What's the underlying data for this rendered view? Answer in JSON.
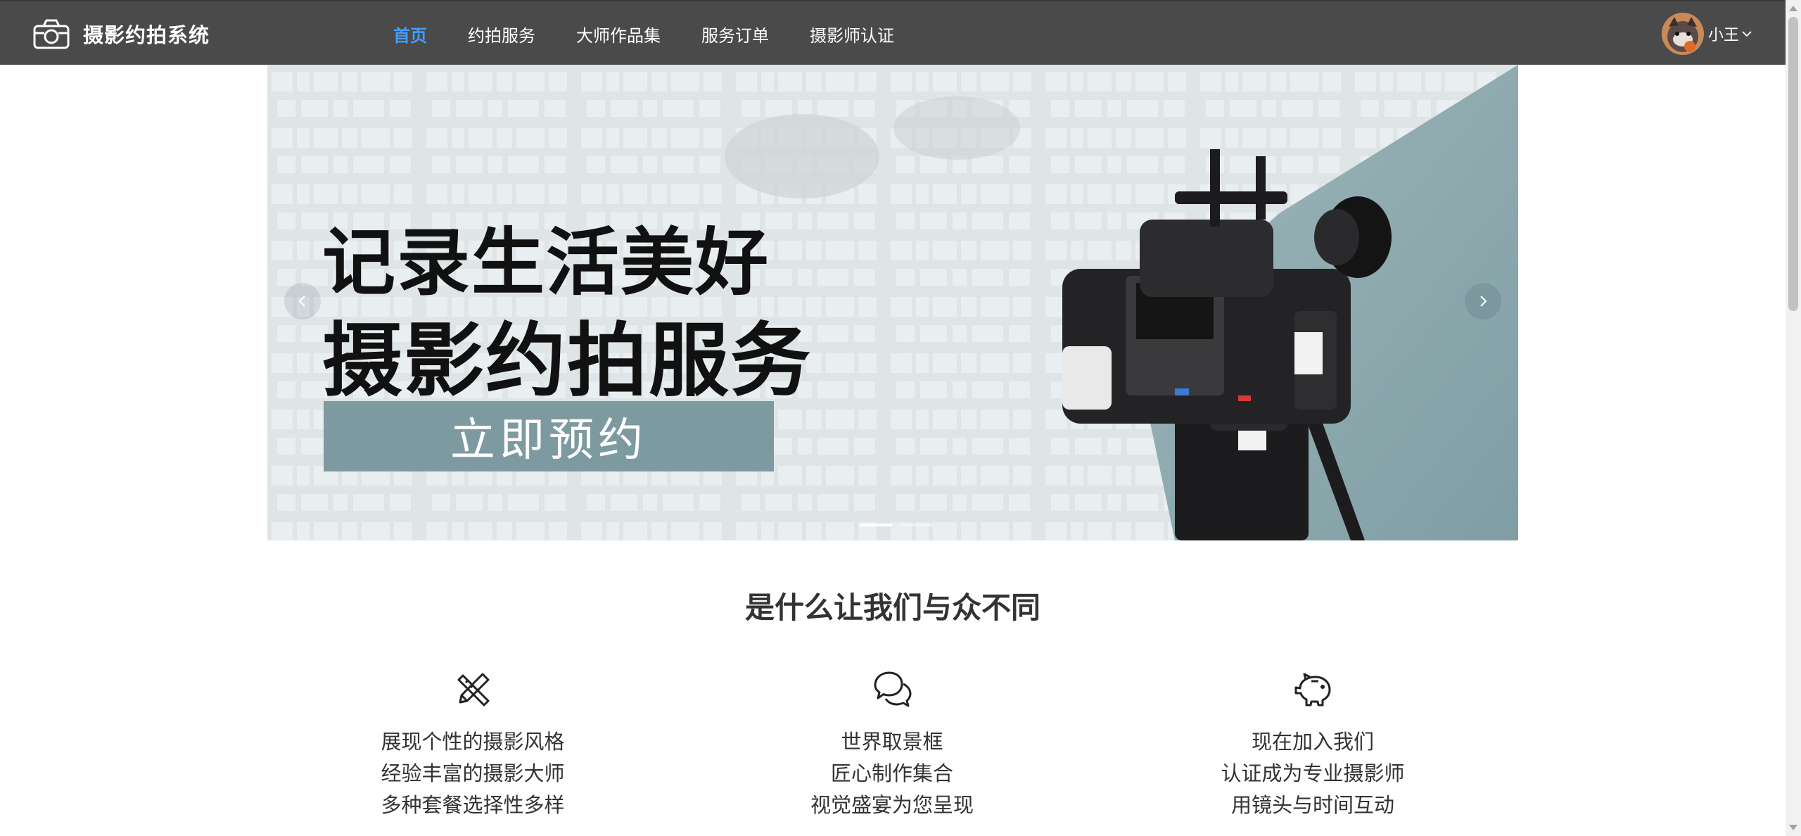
{
  "brand": {
    "title": "摄影约拍系统"
  },
  "nav": {
    "items": [
      {
        "label": "首页",
        "active": true
      },
      {
        "label": "约拍服务",
        "active": false
      },
      {
        "label": "大师作品集",
        "active": false
      },
      {
        "label": "服务订单",
        "active": false
      },
      {
        "label": "摄影师认证",
        "active": false
      }
    ],
    "active_color": "#409eff"
  },
  "user": {
    "name": "小王"
  },
  "banner": {
    "headline_1": "记录生活美好",
    "headline_2": "摄影约拍服务",
    "button_label": "立即预约",
    "slide_count": 2,
    "active_slide": 1
  },
  "features": {
    "title": "是什么让我们与众不同",
    "columns": [
      {
        "icon": "ruler-pencil-icon",
        "lines": [
          "展现个性的摄影风格",
          "经验丰富的摄影大师",
          "多种套餐选择性多样"
        ]
      },
      {
        "icon": "chat-bubbles-icon",
        "lines": [
          "世界取景框",
          "匠心制作集合",
          "视觉盛宴为您呈现"
        ]
      },
      {
        "icon": "piggy-bank-icon",
        "lines": [
          "现在加入我们",
          "认证成为专业摄影师",
          "用镜头与时间互动"
        ]
      }
    ]
  }
}
